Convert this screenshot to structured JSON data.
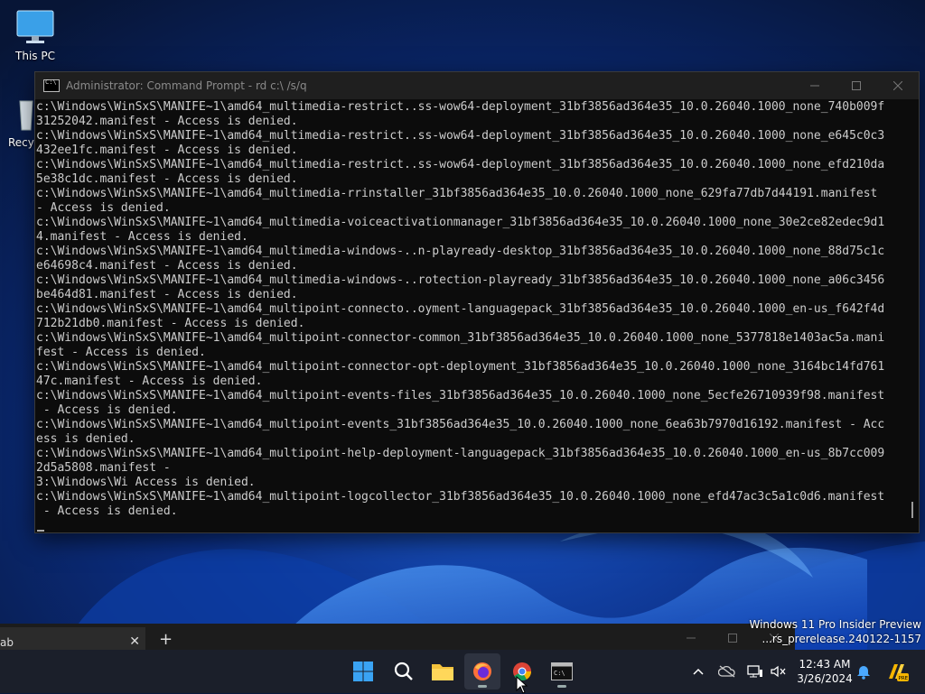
{
  "desktop": {
    "icons": [
      {
        "label": "This PC",
        "icon": "monitor-icon"
      },
      {
        "label": "Recyc",
        "icon": "recycle-bin-icon"
      }
    ]
  },
  "cmd_window": {
    "title": "Administrator: Command Prompt - rd  c:\\ /s/q",
    "lines": [
      "c:\\Windows\\WinSxS\\MANIFE~1\\amd64_multimedia-restrict..ss-wow64-deployment_31bf3856ad364e35_10.0.26040.1000_none_740b009f",
      "31252042.manifest - Access is denied.",
      "c:\\Windows\\WinSxS\\MANIFE~1\\amd64_multimedia-restrict..ss-wow64-deployment_31bf3856ad364e35_10.0.26040.1000_none_e645c0c3",
      "432ee1fc.manifest - Access is denied.",
      "c:\\Windows\\WinSxS\\MANIFE~1\\amd64_multimedia-restrict..ss-wow64-deployment_31bf3856ad364e35_10.0.26040.1000_none_efd210da",
      "5e38c1dc.manifest - Access is denied.",
      "c:\\Windows\\WinSxS\\MANIFE~1\\amd64_multimedia-rrinstaller_31bf3856ad364e35_10.0.26040.1000_none_629fa77db7d44191.manifest",
      "- Access is denied.",
      "c:\\Windows\\WinSxS\\MANIFE~1\\amd64_multimedia-voiceactivationmanager_31bf3856ad364e35_10.0.26040.1000_none_30e2ce82edec9d1",
      "4.manifest - Access is denied.",
      "c:\\Windows\\WinSxS\\MANIFE~1\\amd64_multimedia-windows-..n-playready-desktop_31bf3856ad364e35_10.0.26040.1000_none_88d75c1c",
      "e64698c4.manifest - Access is denied.",
      "c:\\Windows\\WinSxS\\MANIFE~1\\amd64_multimedia-windows-..rotection-playready_31bf3856ad364e35_10.0.26040.1000_none_a06c3456",
      "be464d81.manifest - Access is denied.",
      "c:\\Windows\\WinSxS\\MANIFE~1\\amd64_multipoint-connecto..oyment-languagepack_31bf3856ad364e35_10.0.26040.1000_en-us_f642f4d",
      "712b21db0.manifest - Access is denied.",
      "c:\\Windows\\WinSxS\\MANIFE~1\\amd64_multipoint-connector-common_31bf3856ad364e35_10.0.26040.1000_none_5377818e1403ac5a.mani",
      "fest - Access is denied.",
      "c:\\Windows\\WinSxS\\MANIFE~1\\amd64_multipoint-connector-opt-deployment_31bf3856ad364e35_10.0.26040.1000_none_3164bc14fd761",
      "47c.manifest - Access is denied.",
      "c:\\Windows\\WinSxS\\MANIFE~1\\amd64_multipoint-events-files_31bf3856ad364e35_10.0.26040.1000_none_5ecfe26710939f98.manifest",
      " - Access is denied.",
      "c:\\Windows\\WinSxS\\MANIFE~1\\amd64_multipoint-events_31bf3856ad364e35_10.0.26040.1000_none_6ea63b7970d16192.manifest - Acc",
      "ess is denied.",
      "c:\\Windows\\WinSxS\\MANIFE~1\\amd64_multipoint-help-deployment-languagepack_31bf3856ad364e35_10.0.26040.1000_en-us_8b7cc009",
      "2d5a5808.manifest -",
      "3:\\Windows\\Wi Access is denied.",
      "c:\\Windows\\WinSxS\\MANIFE~1\\amd64_multipoint-logcollector_31bf3856ad364e35_10.0.26040.1000_none_efd47ac3c5a1c0d6.manifest",
      " - Access is denied."
    ]
  },
  "background_window": {
    "tab_label": "ab",
    "tab_close": "✕",
    "new_tab": "+"
  },
  "watermark": {
    "line1": "Windows 11 Pro Insider Preview",
    "line2": "...rs_prerelease.240122-1157"
  },
  "taskbar": {
    "items": [
      "start-icon",
      "search-icon",
      "file-explorer-icon",
      "firefox-icon",
      "chrome-icon",
      "terminal-icon"
    ],
    "clock": {
      "time": "12:43 AM",
      "date": "3/26/2024"
    }
  },
  "colors": {
    "terminal_bg": "#0c0c0c",
    "terminal_fg": "#cccccc",
    "taskbar_bg": "#1b1f2a"
  }
}
